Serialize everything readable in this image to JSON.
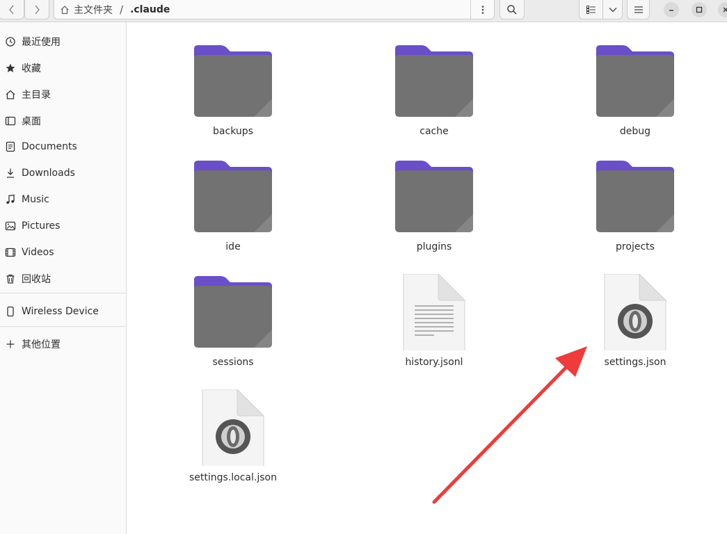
{
  "header": {
    "home_label": "主文件夹",
    "separator": "/",
    "current_folder": ".claude",
    "back_icon": "chevron-left-icon",
    "forward_icon": "chevron-right-icon",
    "path_menu_icon": "vertical-dots-icon",
    "search_icon": "search-icon",
    "view_list_icon": "list-view-icon",
    "view_dropdown_icon": "chevron-down-icon",
    "main_menu_icon": "hamburger-icon",
    "minimize_icon": "minimize-icon",
    "maximize_icon": "maximize-icon",
    "close_icon": "close-icon"
  },
  "sidebar": {
    "items": [
      {
        "label": "最近使用",
        "icon": "clock-icon"
      },
      {
        "label": "收藏",
        "icon": "star-icon"
      },
      {
        "label": "主目录",
        "icon": "home-icon"
      },
      {
        "label": "桌面",
        "icon": "desktop-icon"
      },
      {
        "label": "Documents",
        "icon": "document-icon"
      },
      {
        "label": "Downloads",
        "icon": "download-icon"
      },
      {
        "label": "Music",
        "icon": "music-icon"
      },
      {
        "label": "Pictures",
        "icon": "picture-icon"
      },
      {
        "label": "Videos",
        "icon": "video-icon"
      },
      {
        "label": "回收站",
        "icon": "trash-icon"
      },
      {
        "label": "Wireless Device",
        "icon": "phone-icon"
      },
      {
        "label": "其他位置",
        "icon": "plus-icon"
      }
    ]
  },
  "files": [
    {
      "name": "backups",
      "kind": "folder"
    },
    {
      "name": "cache",
      "kind": "folder"
    },
    {
      "name": "debug",
      "kind": "folder"
    },
    {
      "name": "ide",
      "kind": "folder"
    },
    {
      "name": "plugins",
      "kind": "folder"
    },
    {
      "name": "projects",
      "kind": "folder"
    },
    {
      "name": "sessions",
      "kind": "folder"
    },
    {
      "name": "history.jsonl",
      "kind": "text-file"
    },
    {
      "name": "settings.json",
      "kind": "json-file"
    },
    {
      "name": "settings.local.json",
      "kind": "json-file"
    }
  ],
  "colors": {
    "folder_tab": "#6a4fc9",
    "folder_body": "#727272",
    "annotation_arrow": "#ef3b3b"
  }
}
